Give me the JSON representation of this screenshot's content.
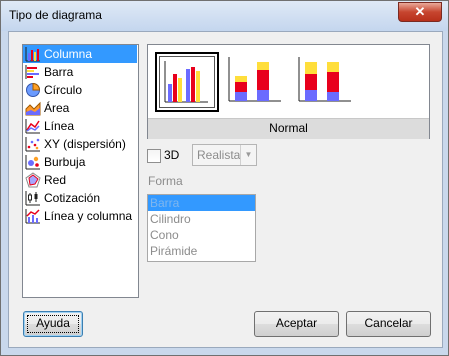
{
  "window": {
    "title": "Tipo de diagrama",
    "close_glyph": "✕"
  },
  "chart_types": [
    {
      "label": "Columna",
      "icon": "column-chart-icon",
      "selected": true
    },
    {
      "label": "Barra",
      "icon": "bar-chart-icon"
    },
    {
      "label": "Círculo",
      "icon": "pie-chart-icon"
    },
    {
      "label": "Área",
      "icon": "area-chart-icon"
    },
    {
      "label": "Línea",
      "icon": "line-chart-icon"
    },
    {
      "label": "XY (dispersión)",
      "icon": "scatter-chart-icon"
    },
    {
      "label": "Burbuja",
      "icon": "bubble-chart-icon"
    },
    {
      "label": "Red",
      "icon": "net-chart-icon"
    },
    {
      "label": "Cotización",
      "icon": "stock-chart-icon"
    },
    {
      "label": "Línea y columna",
      "icon": "column-line-chart-icon"
    }
  ],
  "variants": {
    "caption": "Normal",
    "items": [
      "normal-column-icon",
      "stacked-column-icon",
      "percent-stacked-column-icon"
    ]
  },
  "three_d": {
    "label": "3D",
    "checked": false,
    "mode": "Realista"
  },
  "shape": {
    "label": "Forma",
    "options": [
      "Barra",
      "Cilindro",
      "Cono",
      "Pirámide"
    ],
    "selected": "Barra"
  },
  "buttons": {
    "help": "Ayuda",
    "ok": "Aceptar",
    "cancel": "Cancelar"
  },
  "colors": {
    "series_blue": "#6b6bff",
    "series_red": "#e8001c",
    "series_yellow": "#ffde3b",
    "selection": "#3399ff"
  }
}
